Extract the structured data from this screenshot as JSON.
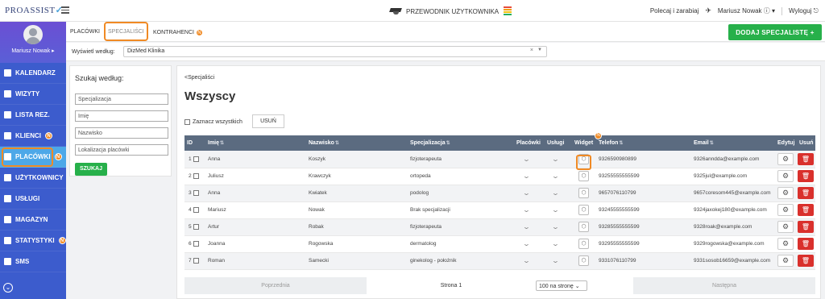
{
  "app": {
    "logo_text": "PROASSIST",
    "guide_label": "PRZEWODNIK UŻYTKOWNIKA",
    "recommend_label": "Polecaj i zarabiaj",
    "user_label": "Mariusz Nowak",
    "logout_label": "Wyloguj"
  },
  "sidebar": {
    "profile_name": "Mariusz Nowak ▸",
    "items": [
      {
        "label": "KALENDARZ",
        "badge": ""
      },
      {
        "label": "WIZYTY",
        "badge": ""
      },
      {
        "label": "LISTA REZ.",
        "badge": ""
      },
      {
        "label": "KLIENCI",
        "badge": "N"
      },
      {
        "label": "PLACÓWKI",
        "badge": "N"
      },
      {
        "label": "UŻYTKOWNICY",
        "badge": ""
      },
      {
        "label": "USŁUGI",
        "badge": ""
      },
      {
        "label": "MAGAZYN",
        "badge": ""
      },
      {
        "label": "STATYSTYKI",
        "badge": "N"
      },
      {
        "label": "SMS",
        "badge": ""
      }
    ]
  },
  "tabs": [
    {
      "label": "PLACÓWKI"
    },
    {
      "label": "SPECJALIŚCI"
    },
    {
      "label": "KONTRAHENCI",
      "badge": "N"
    }
  ],
  "add_button": "DODAJ SPECJALISTĘ +",
  "filter": {
    "label": "Wyświetl według:",
    "value": "DizMed Klinika"
  },
  "search": {
    "title": "Szukaj według:",
    "fields": [
      "Specjalizacja",
      "Imię",
      "Nazwisko",
      "Lokalizacja placówki"
    ],
    "button": "SZUKAJ"
  },
  "main": {
    "breadcrumb": "<Specjaliści",
    "heading": "Wszyscy",
    "select_all": "Zaznacz wszystkich",
    "delete_button": "USUŃ"
  },
  "table": {
    "columns": [
      "ID",
      "Imię",
      "Nazwisko",
      "Specjalizacja",
      "Placówki",
      "Usługi",
      "Widget",
      "Telefon",
      "Email",
      "Edytuj",
      "Usuń"
    ],
    "rows": [
      {
        "id": "1",
        "first": "Anna",
        "last": "Koszyk",
        "spec": "fizjoterapeuta",
        "phone": "9326590980899",
        "email": "9326anndda@example.com"
      },
      {
        "id": "2",
        "first": "Juliusz",
        "last": "Krawczyk",
        "spec": "ortopeda",
        "phone": "93255555555599",
        "email": "9325jul@example.com"
      },
      {
        "id": "3",
        "first": "Anna",
        "last": "Kwiatek",
        "spec": "podolog",
        "phone": "9657076110799",
        "email": "9657coresom445@example.com"
      },
      {
        "id": "4",
        "first": "Mariusz",
        "last": "Nowak",
        "spec": "Brak specjalizacji",
        "phone": "93245555555599",
        "email": "9324jaxokej180@example.com"
      },
      {
        "id": "5",
        "first": "Artur",
        "last": "Robak",
        "spec": "fizjoterapeuta",
        "phone": "93285555555599",
        "email": "9328roak@example.com"
      },
      {
        "id": "6",
        "first": "Joanna",
        "last": "Rogowska",
        "spec": "dermatolog",
        "phone": "93295555555599",
        "email": "9329rogowska@example.com"
      },
      {
        "id": "7",
        "first": "Roman",
        "last": "Samecki",
        "spec": "ginekolog - położnik",
        "phone": "9331076110799",
        "email": "9331sosob16659@example.com"
      }
    ]
  },
  "pager": {
    "prev": "Poprzednia",
    "page": "Strona 1",
    "per_page": "100 na stronę",
    "next": "Następna"
  },
  "colors": {
    "sidebar": "#3c5ccd",
    "active_nav": "#4da8e8",
    "accent_green": "#27b04a",
    "highlight_orange": "#f08a24",
    "table_header": "#5b6b80",
    "delete_red": "#d9302c"
  }
}
